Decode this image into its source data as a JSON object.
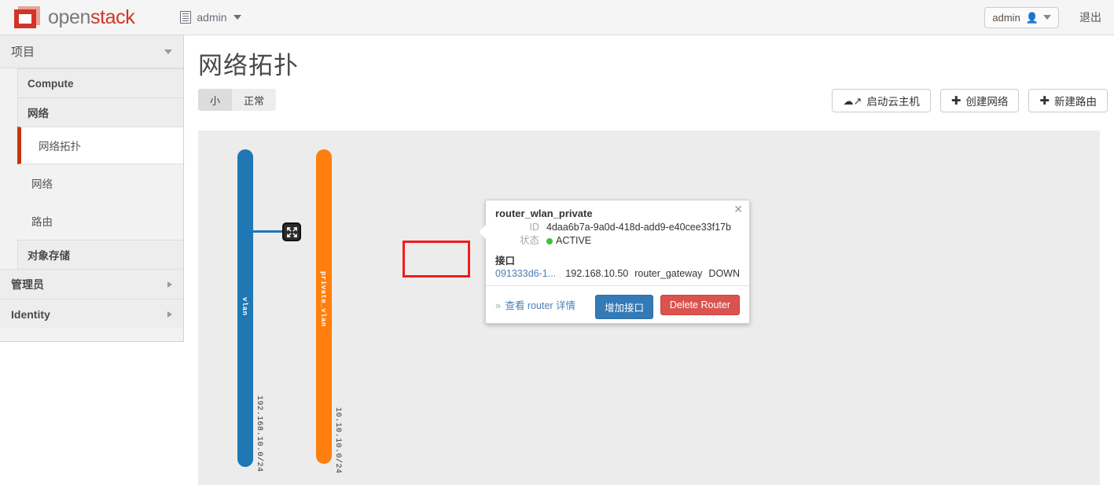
{
  "navbar": {
    "logo_text_1": "open",
    "logo_text_2": "stack",
    "tenant": "admin",
    "tenant_icon": "list-document-icon",
    "user": "admin",
    "user_icon": "person-icon",
    "logout": "退出"
  },
  "sidebar": {
    "project_header": "项目",
    "groups": [
      {
        "label": "Compute",
        "expanded": false
      },
      {
        "label": "网络",
        "expanded": true
      }
    ],
    "network_items": [
      {
        "label": "网络拓扑",
        "active": true
      },
      {
        "label": "网络",
        "active": false
      },
      {
        "label": "路由",
        "active": false
      }
    ],
    "object_storage": "对象存储",
    "admin_header": "管理员",
    "identity_header": "Identity"
  },
  "main": {
    "page_title": "网络拓扑",
    "toggle": [
      {
        "label": "小",
        "selected": true
      },
      {
        "label": "正常",
        "selected": false
      }
    ],
    "actions": [
      {
        "label": "启动云主机",
        "icon": "cloud-upload-icon"
      },
      {
        "label": "创建网络",
        "icon": "plus-icon"
      },
      {
        "label": "新建路由",
        "icon": "plus-icon"
      }
    ]
  },
  "topology": {
    "networks": [
      {
        "name": "vlan",
        "subnet": "192.168.10.0/24",
        "color": "#1f77b4"
      },
      {
        "name": "private_vlan",
        "subnet": "10.10.10.0/24",
        "color": "#ff7f0e"
      }
    ],
    "router_icon": "router-move-icon"
  },
  "popup": {
    "title": "router_wlan_private",
    "close_icon": "close-icon",
    "id_label": "ID",
    "id_value": "4daa6b7a-9a0d-418d-add9-e40cee33f17b",
    "status_label": "状态",
    "status_value": "ACTIVE",
    "status_color": "#3fbf3f",
    "interfaces_label": "接口",
    "interfaces": [
      {
        "id": "091333d6-1...",
        "ip": "192.168.10.50",
        "type": "router_gateway",
        "state": "DOWN"
      }
    ],
    "detail_link": "查看 router 详情",
    "detail_chevron": "»",
    "add_interface": "增加接口",
    "delete_router": "Delete Router"
  }
}
